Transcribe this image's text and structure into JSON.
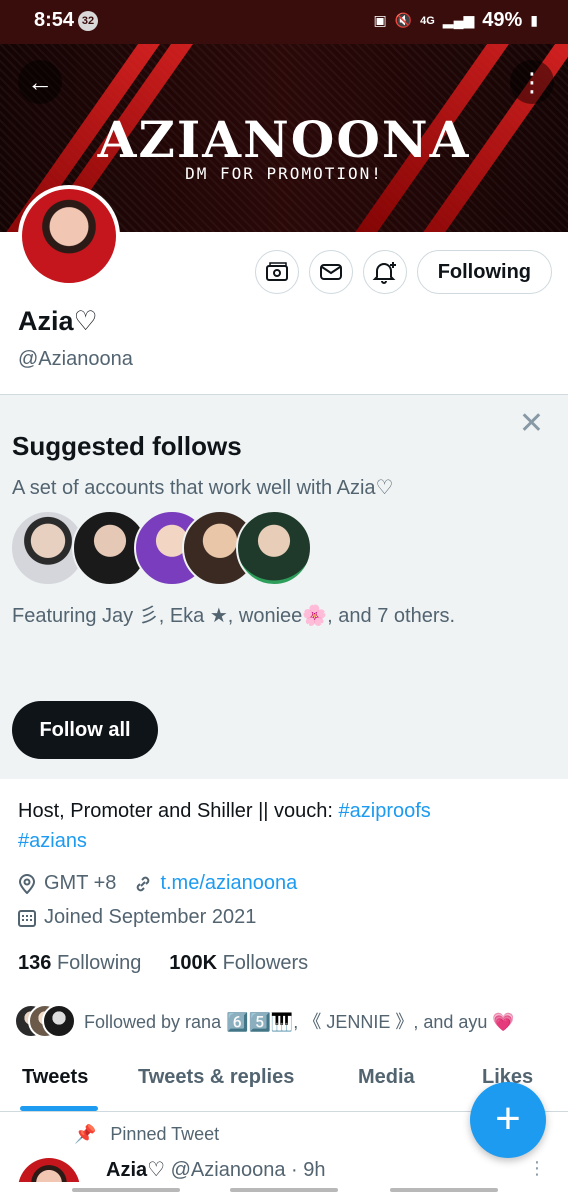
{
  "status_bar": {
    "time": "8:54",
    "notification_count": "32",
    "network": "4G",
    "battery": "49%"
  },
  "banner": {
    "title": "AZIANOONA",
    "subtitle": "DM FOR PROMOTION!"
  },
  "profile": {
    "name": "Azia♡",
    "handle": "@Azianoona",
    "follow_state": "Following"
  },
  "suggested": {
    "title": "Suggested follows",
    "description": "A set of accounts that work well with Azia♡",
    "featuring": "Featuring Jay 彡, Eka ★, woniee🌸, and 7 others.",
    "follow_all_label": "Follow all"
  },
  "bio": {
    "text": "Host, Promoter and Shiller || vouch: ",
    "hashtag1": "#aziproofs",
    "hashtag2": "#azians"
  },
  "meta": {
    "location": "GMT +8",
    "link": "t.me/azianoona",
    "joined": "Joined September 2021"
  },
  "counts": {
    "following_num": "136",
    "following_label": "Following",
    "followers_num": "100K",
    "followers_label": "Followers"
  },
  "followed_by": "Followed by rana 6️⃣5️⃣🎹, 《 JENNIE 》, and ayu 💗",
  "tabs": [
    "Tweets",
    "Tweets & replies",
    "Media",
    "Likes"
  ],
  "pinned": {
    "label": "Pinned Tweet",
    "author_name": "Azia♡",
    "author_meta": "@Azianoona · 9h"
  },
  "colors": {
    "accent": "#1d9bf0",
    "banner_red": "#c4161c",
    "muted_text": "#536471"
  }
}
